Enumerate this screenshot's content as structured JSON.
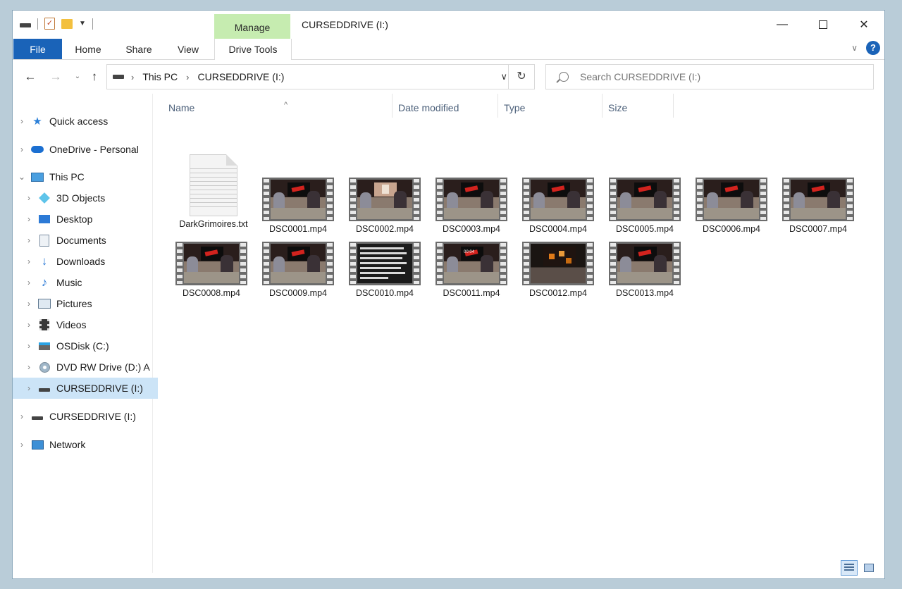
{
  "window": {
    "title": "CURSEDDRIVE (I:)",
    "controls": {
      "minimize": "—",
      "close": "✕"
    }
  },
  "ribbon": {
    "contextual_group": "Manage",
    "tabs": [
      {
        "label": "File"
      },
      {
        "label": "Home"
      },
      {
        "label": "Share"
      },
      {
        "label": "View"
      },
      {
        "label": "Drive Tools"
      }
    ],
    "help": "?"
  },
  "address": {
    "breadcrumbs": [
      "This PC",
      "CURSEDDRIVE (I:)"
    ],
    "search_placeholder": "Search CURSEDDRIVE (I:)"
  },
  "navpane": {
    "items": [
      {
        "label": "Quick access",
        "icon": "star-pin-icon"
      },
      {
        "label": "OneDrive - Personal",
        "icon": "cloud-icon"
      },
      {
        "label": "This PC",
        "icon": "computer-icon"
      },
      {
        "label": "3D Objects",
        "icon": "cube-icon"
      },
      {
        "label": "Desktop",
        "icon": "desktop-icon"
      },
      {
        "label": "Documents",
        "icon": "document-icon"
      },
      {
        "label": "Downloads",
        "icon": "download-arrow-icon"
      },
      {
        "label": "Music",
        "icon": "music-note-icon"
      },
      {
        "label": "Pictures",
        "icon": "picture-icon"
      },
      {
        "label": "Videos",
        "icon": "film-icon"
      },
      {
        "label": "OSDisk (C:)",
        "icon": "windows-drive-icon"
      },
      {
        "label": "DVD RW Drive (D:) A",
        "icon": "disc-icon"
      },
      {
        "label": "CURSEDDRIVE (I:)",
        "icon": "usb-drive-icon",
        "selected": true
      },
      {
        "label": "CURSEDDRIVE (I:)",
        "icon": "usb-drive-icon"
      },
      {
        "label": "Network",
        "icon": "network-icon"
      }
    ]
  },
  "columns": [
    "Name",
    "Date modified",
    "Type",
    "Size"
  ],
  "files": [
    {
      "name": "DarkGrimoires.txt",
      "kind": "text"
    },
    {
      "name": "DSC0001.mp4",
      "kind": "video"
    },
    {
      "name": "DSC0002.mp4",
      "kind": "video"
    },
    {
      "name": "DSC0003.mp4",
      "kind": "video"
    },
    {
      "name": "DSC0004.mp4",
      "kind": "video"
    },
    {
      "name": "DSC0005.mp4",
      "kind": "video"
    },
    {
      "name": "DSC0006.mp4",
      "kind": "video"
    },
    {
      "name": "DSC0007.mp4",
      "kind": "video"
    },
    {
      "name": "DSC0008.mp4",
      "kind": "video"
    },
    {
      "name": "DSC0009.mp4",
      "kind": "video"
    },
    {
      "name": "DSC0010.mp4",
      "kind": "video"
    },
    {
      "name": "DSC0011.mp4",
      "kind": "video",
      "overlay": "00:04"
    },
    {
      "name": "DSC0012.mp4",
      "kind": "video"
    },
    {
      "name": "DSC0013.mp4",
      "kind": "video"
    }
  ],
  "colors": {
    "accent": "#1a63b8",
    "manage_tab": "#c6ecb0",
    "selection": "#cce4f7"
  }
}
